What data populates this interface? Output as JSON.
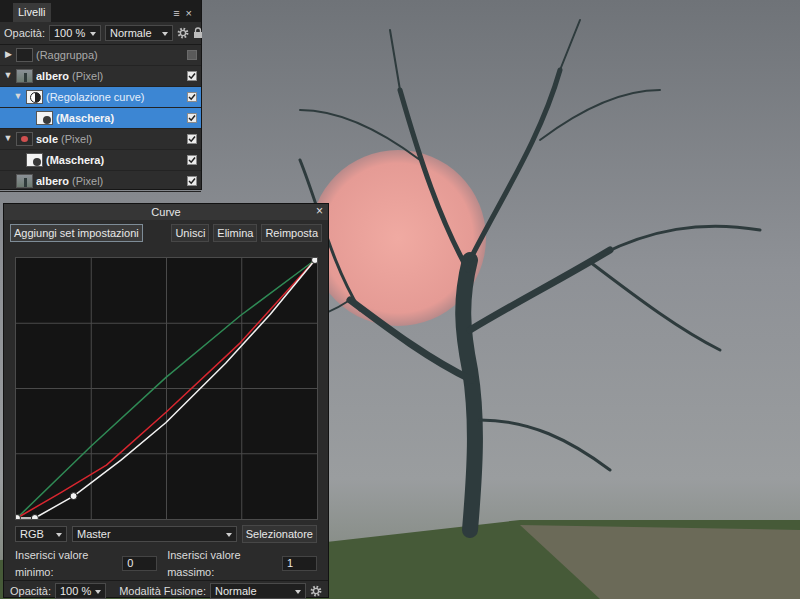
{
  "layers_panel": {
    "tab": "Livelli",
    "menu_glyph": "≡",
    "close_glyph": "×",
    "opacity_label": "Opacità:",
    "opacity": "100 %",
    "blend_mode": "Normale",
    "layers": [
      {
        "toggle": "▶",
        "expanded": false,
        "depth": 0,
        "thumb": "group",
        "label": "",
        "detail": "(Raggruppa)",
        "checked": false,
        "selected": false
      },
      {
        "toggle": "▼",
        "expanded": true,
        "depth": 0,
        "thumb": "pixel",
        "label": "albero",
        "detail": " (Pixel)",
        "checked": true,
        "selected": false
      },
      {
        "toggle": "▼",
        "expanded": true,
        "depth": 1,
        "thumb": "adjust",
        "label": "",
        "detail": "(Regolazione curve)",
        "checked": true,
        "selected": true
      },
      {
        "toggle": "",
        "expanded": false,
        "depth": 2,
        "thumb": "mask",
        "label": "(Maschera)",
        "detail": "",
        "checked": true,
        "selected": true
      },
      {
        "toggle": "▼",
        "expanded": true,
        "depth": 0,
        "thumb": "sun",
        "label": "sole",
        "detail": " (Pixel)",
        "checked": true,
        "selected": false
      },
      {
        "toggle": "",
        "expanded": false,
        "depth": 1,
        "thumb": "mask",
        "label": "(Maschera)",
        "detail": "",
        "checked": true,
        "selected": false
      },
      {
        "toggle": "",
        "expanded": false,
        "depth": 0,
        "thumb": "pixel",
        "label": "albero",
        "detail": " (Pixel)",
        "checked": true,
        "selected": false
      }
    ]
  },
  "curves_dialog": {
    "title": "Curve",
    "close_glyph": "×",
    "buttons": [
      {
        "label": "Aggiungi set impostazioni",
        "focused": true
      },
      {
        "label": "Unisci",
        "focused": false
      },
      {
        "label": "Elimina",
        "focused": false
      },
      {
        "label": "Reimposta",
        "focused": false
      }
    ],
    "chart": {
      "series": [
        {
          "name": "green",
          "color": "#2f8a55",
          "points": [
            [
              0,
              0
            ],
            [
              0.25,
              0.28
            ],
            [
              0.5,
              0.545
            ],
            [
              0.75,
              0.785
            ],
            [
              1,
              1
            ]
          ],
          "handles": []
        },
        {
          "name": "red",
          "color": "#d8262f",
          "points": [
            [
              0,
              0
            ],
            [
              0.15,
              0.1
            ],
            [
              0.3,
              0.205
            ],
            [
              0.5,
              0.41
            ],
            [
              0.75,
              0.68
            ],
            [
              1,
              1
            ]
          ],
          "handles": []
        },
        {
          "name": "master",
          "color": "#f2f2f2",
          "points": [
            [
              0,
              0
            ],
            [
              0.06,
              0
            ],
            [
              0.19,
              0.085
            ],
            [
              0.35,
              0.225
            ],
            [
              0.5,
              0.37
            ],
            [
              0.7,
              0.6
            ],
            [
              0.85,
              0.79
            ],
            [
              1,
              1
            ]
          ],
          "handles": [
            [
              0,
              0
            ],
            [
              0.06,
              0
            ],
            [
              0.19,
              0.085
            ],
            [
              1,
              1
            ]
          ]
        }
      ]
    },
    "channel_mode": "RGB",
    "channel": "Master",
    "picker_button": "Selezionatore",
    "min_label": "Inserisci valore minimo:",
    "min_value": "0",
    "max_label": "Inserisci valore massimo:",
    "max_value": "1",
    "opacity_label": "Opacità:",
    "opacity": "100 %",
    "blend_label": "Modalità Fusione:",
    "blend_mode": "Normale"
  }
}
